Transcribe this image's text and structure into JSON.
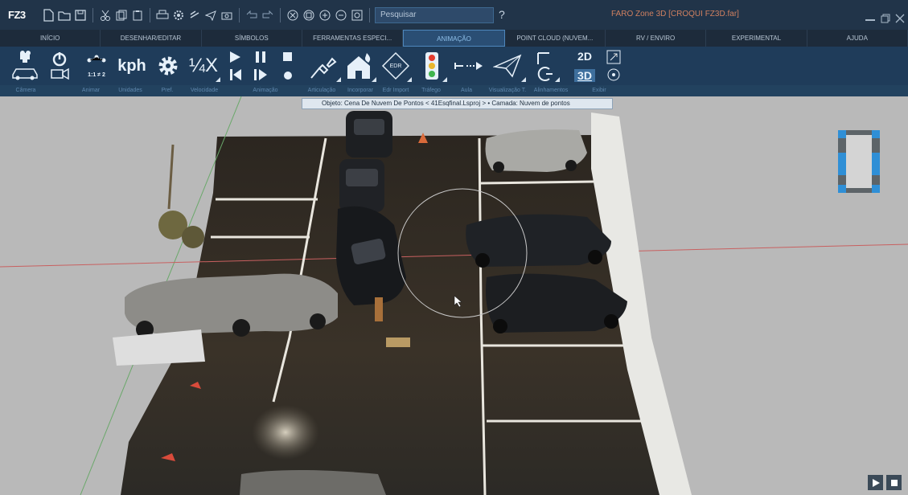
{
  "app": {
    "logo": "FZ3",
    "title": "FARO Zone 3D [CROQUI FZ3D.far]"
  },
  "search": {
    "placeholder": "Pesquisar"
  },
  "help_symbol": "?",
  "ribbon_tabs": [
    {
      "label": "INÍCIO",
      "active": false
    },
    {
      "label": "DESENHAR/EDITAR",
      "active": false
    },
    {
      "label": "SÍMBOLOS",
      "active": false
    },
    {
      "label": "FERRAMENTAS ESPECI...",
      "active": false
    },
    {
      "label": "ANIMAÇÃO",
      "active": true
    },
    {
      "label": "POINT CLOUD (NUVEM...",
      "active": false
    },
    {
      "label": "RV / ENVIRO",
      "active": false
    },
    {
      "label": "EXPERIMENTAL",
      "active": false
    },
    {
      "label": "AJUDA",
      "active": false
    }
  ],
  "tools": {
    "units_kph": "kph",
    "speed": "¼X",
    "ratio": "1:1 ≠ 2",
    "view_2d": "2D",
    "view_3d": "3D",
    "edr": "EDR"
  },
  "groups": [
    "Câmera",
    "Animar",
    "Unidades",
    "Pref.",
    "Velocidade",
    "Animação",
    "Articulação",
    "Incorporar",
    "Edr Import",
    "Tráfego",
    "Aula",
    "Visualização T.",
    "Alinhamentos",
    "Exibir"
  ],
  "status": {
    "object_info": "Objeto: Cena De Nuvem De Pontos < 41Esqfinal.Lsproj >  •  Camada: Nuvem de pontos"
  },
  "colors": {
    "titlebar": "#213449",
    "ribbon": "#1f3c5a",
    "active_tab": "#2a4e74",
    "accent": "#4d86bb"
  }
}
